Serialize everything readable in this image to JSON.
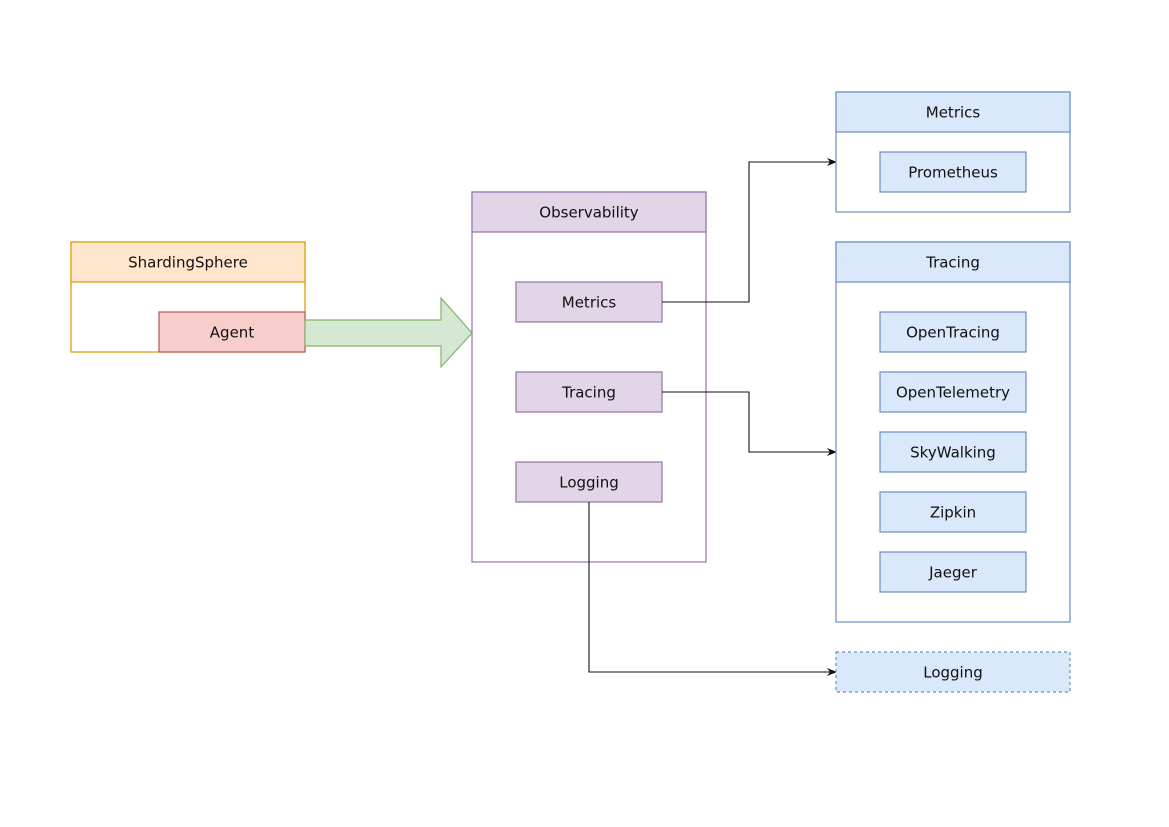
{
  "nodes": {
    "shardingsphere": "ShardingSphere",
    "agent": "Agent",
    "observability": "Observability",
    "obs_metrics": "Metrics",
    "obs_tracing": "Tracing",
    "obs_logging": "Logging",
    "metrics_group": "Metrics",
    "prometheus": "Prometheus",
    "tracing_group": "Tracing",
    "opentracing": "OpenTracing",
    "opentelemetry": "OpenTelemetry",
    "skywalking": "SkyWalking",
    "zipkin": "Zipkin",
    "jaeger": "Jaeger",
    "logging_target": "Logging"
  },
  "colors": {
    "orange_fill": "#ffe6cc",
    "orange_stroke": "#d79b00",
    "red_fill": "#f8cecc",
    "red_stroke": "#b85450",
    "green_fill": "#d5e8d4",
    "green_stroke": "#82b366",
    "purple_fill": "#e1d5e7",
    "purple_stroke": "#9673a6",
    "blue_fill": "#dae8fc",
    "blue_stroke": "#6c8ebf"
  }
}
